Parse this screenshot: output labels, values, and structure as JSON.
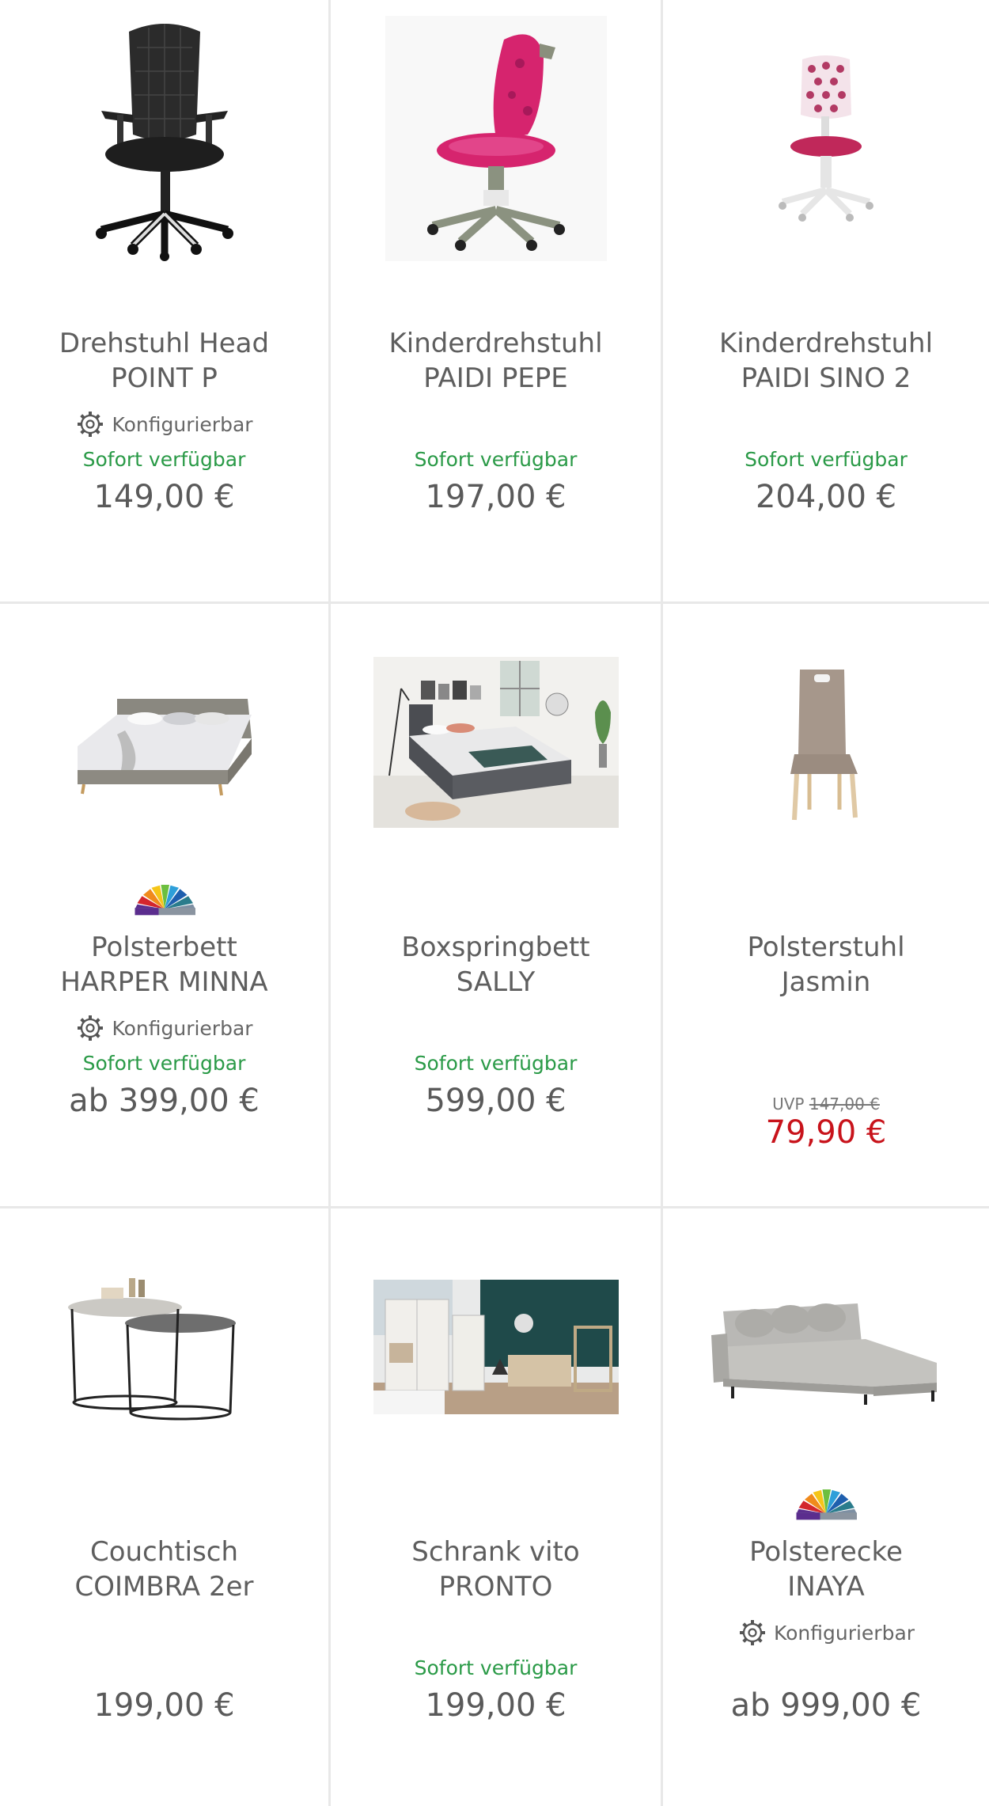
{
  "products": [
    {
      "title_1": "Drehstuhl Head",
      "title_2": "POINT P",
      "configurable": "Konfigurierbar",
      "availability": "Sofort verfügbar",
      "price": "149,00 €",
      "image": "office-chair-image"
    },
    {
      "title_1": "Kinderdrehstuhl",
      "title_2": "PAIDI PEPE",
      "availability": "Sofort verfügbar",
      "price": "197,00 €",
      "image": "kids-chair-pink-image"
    },
    {
      "title_1": "Kinderdrehstuhl",
      "title_2": "PAIDI SINO 2",
      "availability": "Sofort verfügbar",
      "price": "204,00 €",
      "image": "kids-chair-dotted-image"
    },
    {
      "title_1": "Polsterbett",
      "title_2": "HARPER MINNA",
      "configurable": "Konfigurierbar",
      "availability": "Sofort verfügbar",
      "price": "ab 399,00 €",
      "image": "upholstered-bed-image",
      "swatch": "color-swatch-icon"
    },
    {
      "title_1": "Boxspringbett",
      "title_2": "SALLY",
      "availability": "Sofort verfügbar",
      "price": "599,00 €",
      "image": "boxspring-bed-room-image"
    },
    {
      "title_1": "Polsterstuhl",
      "title_2": "Jasmin",
      "uvp_label": "UVP",
      "uvp_price": "147,00 €",
      "price": "79,90 €",
      "image": "dining-chair-image"
    },
    {
      "title_1": "Couchtisch",
      "title_2": "COIMBRA 2er",
      "price": "199,00 €",
      "image": "coffee-tables-image"
    },
    {
      "title_1": "Schrank vito",
      "title_2": "PRONTO",
      "availability": "Sofort verfügbar",
      "price": "199,00 €",
      "image": "wardrobe-room-image"
    },
    {
      "title_1": "Polsterecke",
      "title_2": "INAYA",
      "configurable": "Konfigurierbar",
      "price": "ab 999,00 €",
      "image": "corner-sofa-image",
      "swatch": "color-swatch-icon"
    }
  ],
  "colors": {
    "availability": "#2a9a47",
    "sale_price": "#c8131b",
    "text": "#5e5e5e",
    "divider": "#e8e8e8"
  }
}
